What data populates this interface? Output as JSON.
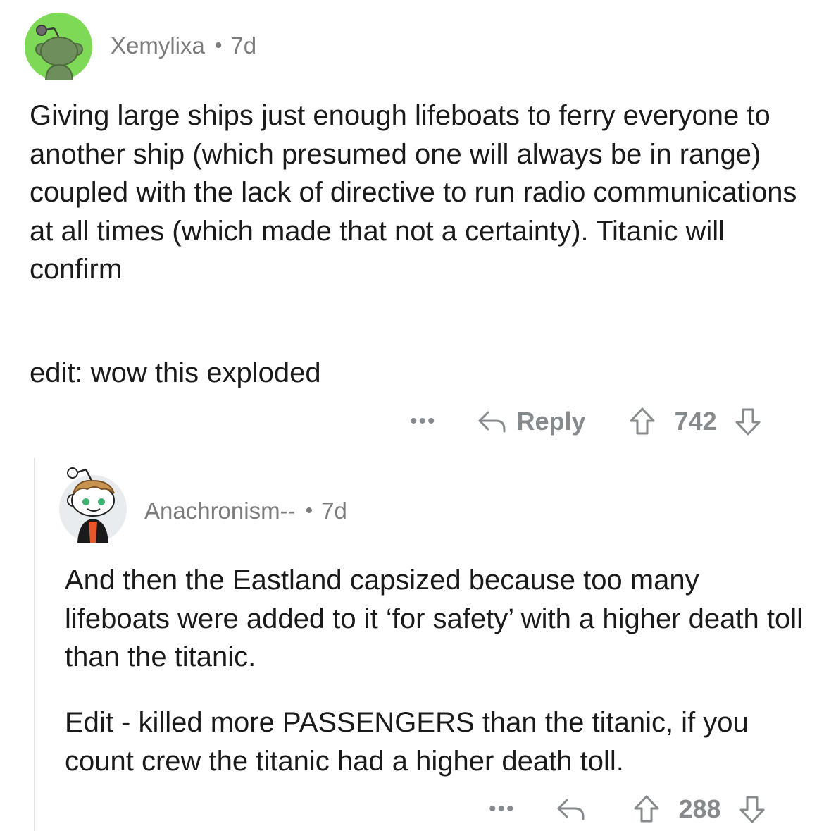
{
  "comments": [
    {
      "username": "Xemylixa",
      "separator": "•",
      "age": "7d",
      "avatar_icon": "snoo-avatar-icon",
      "avatar_color": "#7ed957",
      "paragraphs": [
        "Giving large ships just enough lifeboats to ferry everyone to another ship (which presumed one will always be in range) coupled with the lack of directive to run radio communications at all times (which made that not a certainty). Titanic will confirm",
        "edit: wow this exploded"
      ],
      "actions": {
        "more": "•••",
        "reply_label": "Reply",
        "score": "742"
      }
    },
    {
      "username": "Anachronism--",
      "separator": "•",
      "age": "7d",
      "avatar_icon": "snoo-avatar-icon",
      "avatar_color": "#e9ecee",
      "paragraphs": [
        "And then the Eastland capsized because too many lifeboats were added to it ‘for safety’ with a higher death toll than the titanic.",
        "Edit - killed more PASSENGERS than the titanic, if you count crew the titanic had a higher death toll."
      ],
      "actions": {
        "more": "•••",
        "reply_label": "",
        "score": "288"
      }
    }
  ],
  "colors": {
    "text": "#1a1a1b",
    "meta": "#7c7c7c",
    "action": "#878a8c",
    "thread_line": "#e4e4e4"
  }
}
